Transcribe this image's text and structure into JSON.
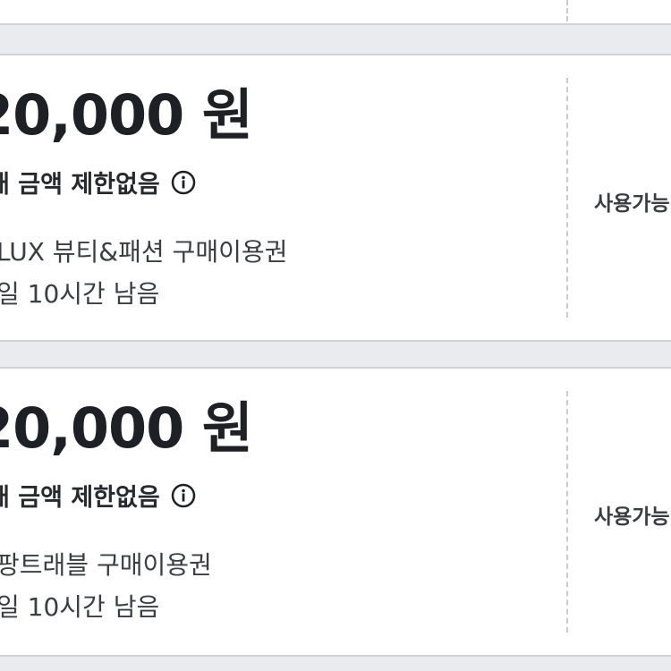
{
  "coupons": [
    {
      "amount": "20,000 원",
      "limit": "매 금액 제한없음",
      "description": "LUX 뷰티&패션 구매이용권",
      "remaining": "일 10시간 남음",
      "status": "사용가능"
    },
    {
      "amount": "20,000 원",
      "limit": "매 금액 제한없음",
      "description": "팡트래블 구매이용권",
      "remaining": "일 10시간 남음",
      "status": "사용가능"
    }
  ]
}
